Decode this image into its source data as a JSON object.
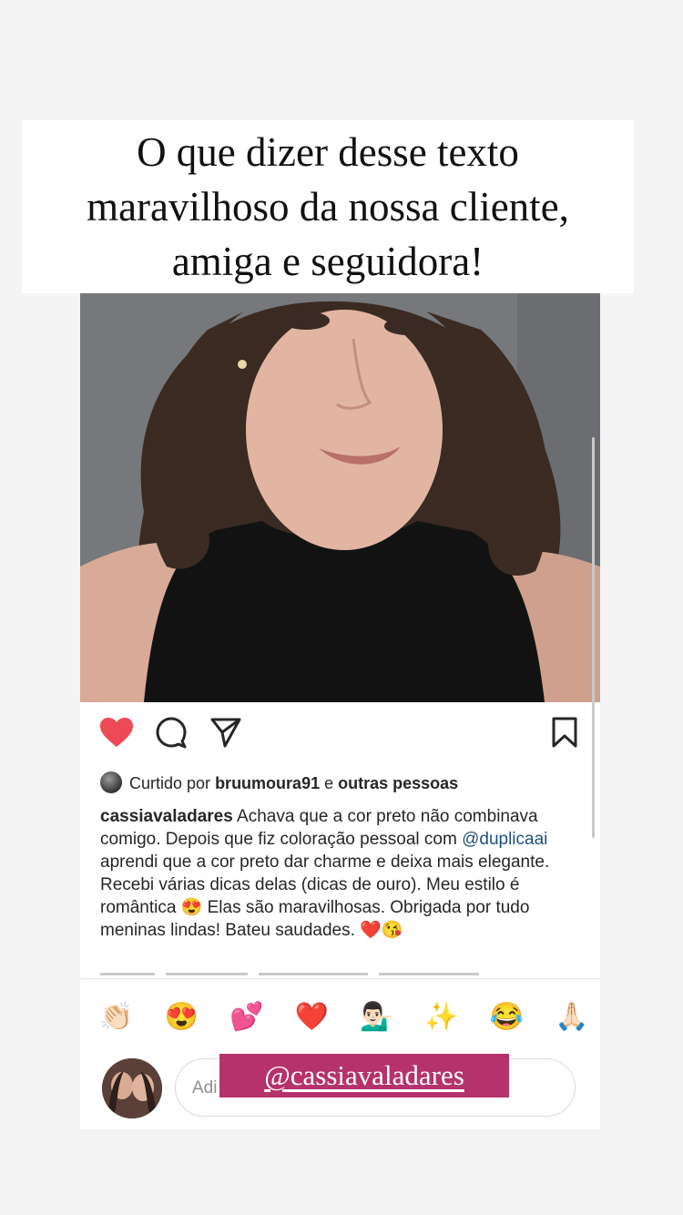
{
  "story_headline": {
    "line1": "O que dizer desse texto",
    "line2": "maravilhoso da nossa cliente,",
    "line3": "amiga e seguidora!"
  },
  "post": {
    "liked_by_prefix": "Curtido por",
    "liked_by_user": "bruumoura91",
    "liked_by_conj": "e",
    "liked_by_others": "outras pessoas",
    "caption": {
      "username": "cassiavaladares",
      "text_1": " Achava que a cor preto não combinava comigo. Depois que fiz coloração pessoal com ",
      "mention": "@duplicaai",
      "text_2": " aprendi que a cor preto dar charme e deixa mais elegante. Recebi várias dicas delas (dicas de ouro). Meu estilo é romântica 😍  Elas são maravilhosas. Obrigada por tudo meninas lindas! Bateu saudades. ❤️😘"
    }
  },
  "quick_reactions": [
    "👏🏻",
    "😍",
    "💕",
    "❤️",
    "💁🏻‍♂️",
    "✨",
    "😂",
    "🙏🏻"
  ],
  "comment": {
    "placeholder": "Adi"
  },
  "mention_sticker": {
    "label": "@cassiavaladares"
  },
  "colors": {
    "like_heart": "#ed4956",
    "mention_sticker_bg": "#b5326d",
    "mention_link": "#1f4f80"
  },
  "icons": {
    "like": "heart-filled-icon",
    "comment": "comment-bubble-icon",
    "share": "paper-plane-icon",
    "save": "bookmark-icon"
  }
}
